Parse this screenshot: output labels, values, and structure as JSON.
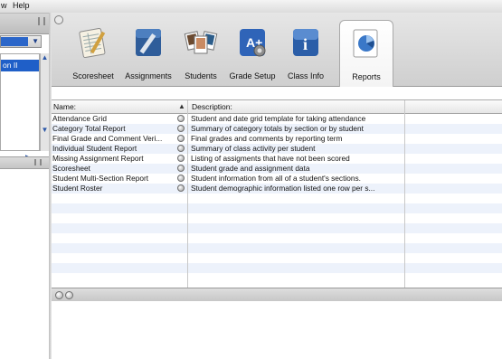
{
  "menubar": {
    "items": [
      "w",
      "Help"
    ]
  },
  "sidebar": {
    "selected_item": "on II"
  },
  "toolbar": {
    "buttons": [
      {
        "label": "Scoresheet",
        "icon": "scoresheet-icon"
      },
      {
        "label": "Assignments",
        "icon": "assignments-icon"
      },
      {
        "label": "Students",
        "icon": "students-icon"
      },
      {
        "label": "Grade Setup",
        "icon": "grade-setup-icon"
      },
      {
        "label": "Class Info",
        "icon": "class-info-icon"
      },
      {
        "label": "Reports",
        "icon": "reports-icon",
        "active": true
      }
    ]
  },
  "table": {
    "headers": {
      "name": "Name:",
      "description": "Description:"
    },
    "rows": [
      {
        "name": "Attendance Grid",
        "description": "Student and date grid template for taking attendance"
      },
      {
        "name": "Category Total Report",
        "description": "Summary of category totals by section or by student"
      },
      {
        "name": "Final Grade and Comment Veri...",
        "description": "Final grades and comments by reporting term"
      },
      {
        "name": "Individual Student Report",
        "description": "Summary of class activity per student"
      },
      {
        "name": "Missing Assignment Report",
        "description": "Listing of assigments that have not been scored"
      },
      {
        "name": "Scoresheet",
        "description": "Student grade and assignment data"
      },
      {
        "name": "Student Multi-Section Report",
        "description": "Student information from all of a student's sections."
      },
      {
        "name": "Student Roster",
        "description": "Student demographic information listed one row per s..."
      }
    ]
  },
  "colors": {
    "selection": "#1f5fc8",
    "alt_row": "#edf2fb",
    "toolbar_bg": "#d9d9d9"
  }
}
